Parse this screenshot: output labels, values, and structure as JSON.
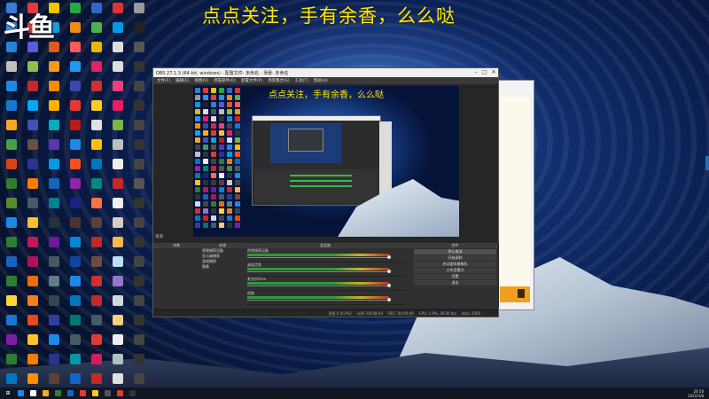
{
  "overlay": {
    "text": "点点关注，手有余香，么么哒"
  },
  "logo": {
    "text": "斗鱼"
  },
  "desktop_icons": [
    {
      "label": "",
      "color": "#3a7bd5"
    },
    {
      "label": "",
      "color": "#e23b3b"
    },
    {
      "label": "",
      "color": "#f5c400"
    },
    {
      "label": "",
      "color": "#27a844"
    },
    {
      "label": "",
      "color": "#2f68c8"
    },
    {
      "label": "",
      "color": "#d33"
    },
    {
      "label": "",
      "color": "#999"
    },
    {
      "label": "",
      "color": "#3b8fe0"
    },
    {
      "label": "",
      "color": "#e04040"
    },
    {
      "label": "",
      "color": "#1c9bd9"
    },
    {
      "label": "",
      "color": "#f08a1c"
    },
    {
      "label": "",
      "color": "#4caf50"
    },
    {
      "label": "",
      "color": "#0099e5"
    },
    {
      "label": "",
      "color": "#222"
    },
    {
      "label": "",
      "color": "#2a82d6"
    },
    {
      "label": "",
      "color": "#5b5bd6"
    },
    {
      "label": "",
      "color": "#e05a1f"
    },
    {
      "label": "",
      "color": "#ff5a5a"
    },
    {
      "label": "",
      "color": "#e8b800"
    },
    {
      "label": "",
      "color": "#ddd"
    },
    {
      "label": "",
      "color": "#555"
    },
    {
      "label": "",
      "color": "#c0c0c0"
    },
    {
      "label": "",
      "color": "#8bc34a"
    },
    {
      "label": "",
      "color": "#f39c12"
    },
    {
      "label": "",
      "color": "#2196f3"
    },
    {
      "label": "",
      "color": "#e91e63"
    },
    {
      "label": "",
      "color": "#ddd"
    },
    {
      "label": "",
      "color": "#333"
    },
    {
      "label": "",
      "color": "#1e88e5"
    },
    {
      "label": "",
      "color": "#c62828"
    },
    {
      "label": "",
      "color": "#fb8c00"
    },
    {
      "label": "",
      "color": "#3949ab"
    },
    {
      "label": "",
      "color": "#d32f2f"
    },
    {
      "label": "",
      "color": "#ec407a"
    },
    {
      "label": "",
      "color": "#444"
    },
    {
      "label": "",
      "color": "#1976d2"
    },
    {
      "label": "",
      "color": "#03a9f4"
    },
    {
      "label": "",
      "color": "#ffb300"
    },
    {
      "label": "",
      "color": "#e53935"
    },
    {
      "label": "",
      "color": "#ffca28"
    },
    {
      "label": "",
      "color": "#e91e63"
    },
    {
      "label": "",
      "color": "#333"
    },
    {
      "label": "",
      "color": "#f9a825"
    },
    {
      "label": "",
      "color": "#3f51b5"
    },
    {
      "label": "",
      "color": "#00acc1"
    },
    {
      "label": "",
      "color": "#b71c1c"
    },
    {
      "label": "",
      "color": "#e0e0e0"
    },
    {
      "label": "",
      "color": "#7cb342"
    },
    {
      "label": "",
      "color": "#444"
    },
    {
      "label": "",
      "color": "#43a047"
    },
    {
      "label": "",
      "color": "#6d4c41"
    },
    {
      "label": "",
      "color": "#5e35b1"
    },
    {
      "label": "",
      "color": "#1e88e5"
    },
    {
      "label": "",
      "color": "#ffc107"
    },
    {
      "label": "",
      "color": "#c0c0c0"
    },
    {
      "label": "",
      "color": "#333"
    },
    {
      "label": "",
      "color": "#d84315"
    },
    {
      "label": "",
      "color": "#283593"
    },
    {
      "label": "",
      "color": "#039be5"
    },
    {
      "label": "",
      "color": "#f4511e"
    },
    {
      "label": "",
      "color": "#0277bd"
    },
    {
      "label": "",
      "color": "#eeeeee"
    },
    {
      "label": "",
      "color": "#444"
    },
    {
      "label": "",
      "color": "#2e7d32"
    },
    {
      "label": "",
      "color": "#f57c00"
    },
    {
      "label": "",
      "color": "#1565c0"
    },
    {
      "label": "",
      "color": "#8e24aa"
    },
    {
      "label": "",
      "color": "#00897b"
    },
    {
      "label": "",
      "color": "#c62828"
    },
    {
      "label": "",
      "color": "#555"
    },
    {
      "label": "",
      "color": "#558b2f"
    },
    {
      "label": "",
      "color": "#455a64"
    },
    {
      "label": "",
      "color": "#00838f"
    },
    {
      "label": "",
      "color": "#1a237e"
    },
    {
      "label": "",
      "color": "#ff7043"
    },
    {
      "label": "",
      "color": "#eceff1"
    },
    {
      "label": "",
      "color": "#333"
    },
    {
      "label": "",
      "color": "#1e88e5"
    },
    {
      "label": "",
      "color": "#fbc02d"
    },
    {
      "label": "",
      "color": "#263238"
    },
    {
      "label": "",
      "color": "#4e342e"
    },
    {
      "label": "",
      "color": "#5d4037"
    },
    {
      "label": "",
      "color": "#d7ccc8"
    },
    {
      "label": "",
      "color": "#444"
    },
    {
      "label": "",
      "color": "#2e7d32"
    },
    {
      "label": "",
      "color": "#c2185b"
    },
    {
      "label": "",
      "color": "#6a1b9a"
    },
    {
      "label": "",
      "color": "#0288d1"
    },
    {
      "label": "",
      "color": "#c62828"
    },
    {
      "label": "",
      "color": "#ffb74d"
    },
    {
      "label": "",
      "color": "#333"
    },
    {
      "label": "",
      "color": "#1565c0"
    },
    {
      "label": "",
      "color": "#ad1457"
    },
    {
      "label": "",
      "color": "#455a64"
    },
    {
      "label": "",
      "color": "#0d47a1"
    },
    {
      "label": "",
      "color": "#6d4c41"
    },
    {
      "label": "",
      "color": "#bbdefb"
    },
    {
      "label": "",
      "color": "#444"
    },
    {
      "label": "",
      "color": "#2e7d32"
    },
    {
      "label": "",
      "color": "#ef6c00"
    },
    {
      "label": "",
      "color": "#607d8b"
    },
    {
      "label": "",
      "color": "#1e88e5"
    },
    {
      "label": "",
      "color": "#d32f2f"
    },
    {
      "label": "",
      "color": "#9575cd"
    },
    {
      "label": "",
      "color": "#333"
    },
    {
      "label": "",
      "color": "#fdd835"
    },
    {
      "label": "",
      "color": "#f57f17"
    },
    {
      "label": "",
      "color": "#37474f"
    },
    {
      "label": "",
      "color": "#0277bd"
    },
    {
      "label": "",
      "color": "#c62828"
    },
    {
      "label": "",
      "color": "#cfd8dc"
    },
    {
      "label": "",
      "color": "#444"
    },
    {
      "label": "",
      "color": "#1976d2"
    },
    {
      "label": "",
      "color": "#e64a19"
    },
    {
      "label": "",
      "color": "#303f9f"
    },
    {
      "label": "",
      "color": "#00796b"
    },
    {
      "label": "",
      "color": "#455a64"
    },
    {
      "label": "",
      "color": "#ffcc80"
    },
    {
      "label": "",
      "color": "#333"
    },
    {
      "label": "",
      "color": "#7b1fa2"
    },
    {
      "label": "",
      "color": "#fbc02d"
    },
    {
      "label": "",
      "color": "#1e88e5"
    },
    {
      "label": "",
      "color": "#455a64"
    },
    {
      "label": "",
      "color": "#e53935"
    },
    {
      "label": "",
      "color": "#eceff1"
    },
    {
      "label": "",
      "color": "#444"
    },
    {
      "label": "",
      "color": "#2e7d32"
    },
    {
      "label": "",
      "color": "#f57c00"
    },
    {
      "label": "",
      "color": "#283593"
    },
    {
      "label": "",
      "color": "#0097a7"
    },
    {
      "label": "",
      "color": "#d81b60"
    },
    {
      "label": "",
      "color": "#b0bec5"
    },
    {
      "label": "",
      "color": "#333"
    },
    {
      "label": "",
      "color": "#0277bd"
    },
    {
      "label": "",
      "color": "#ff8f00"
    },
    {
      "label": "",
      "color": "#5d4037"
    },
    {
      "label": "",
      "color": "#1565c0"
    },
    {
      "label": "",
      "color": "#c62828"
    },
    {
      "label": "",
      "color": "#e0e0e0"
    },
    {
      "label": "",
      "color": "#444"
    }
  ],
  "obs": {
    "title": "OBS 27.1.3 (64-bit, windows) - 配置文件: 未命名 - 场景: 未命名",
    "menu": [
      "文件(F)",
      "编辑(E)",
      "视图(V)",
      "停靠部件(D)",
      "配置文件(P)",
      "场景集合(S)",
      "工具(T)",
      "帮助(H)"
    ],
    "scenes_label": "来源",
    "dock_titles": [
      "场景",
      "来源",
      "混音器",
      "转场",
      "控件"
    ],
    "sources": [
      "视频捕获设备",
      "显示器捕获",
      "游戏捕获",
      "图像"
    ],
    "mixer": [
      {
        "name": "视频捕获设备"
      },
      {
        "name": "桌面音频"
      },
      {
        "name": "麦克风/Aux"
      },
      {
        "name": "图像"
      }
    ],
    "controls": [
      {
        "label": "停止推流",
        "active": true
      },
      {
        "label": "开始录制",
        "active": false
      },
      {
        "label": "启动虚拟摄像机",
        "active": false
      },
      {
        "label": "工作室模式",
        "active": false
      },
      {
        "label": "设置",
        "active": false
      },
      {
        "label": "退出",
        "active": false
      }
    ],
    "status": [
      "丢帧 0 (0.0%)",
      "LIVE: 00:08:44",
      "REC: 00:00:00",
      "CPU: 1.9%, 30.00 fps",
      "kb/s: 2500"
    ]
  },
  "taskbar": {
    "items": [
      "#1e88e5",
      "#ffffff",
      "#f9a825",
      "#2e7d32",
      "#1565c0",
      "#e53935",
      "#ffca28",
      "#555555",
      "#e53935",
      "#333333"
    ],
    "clock_time": "20:58",
    "clock_date": "2022/3/8"
  }
}
